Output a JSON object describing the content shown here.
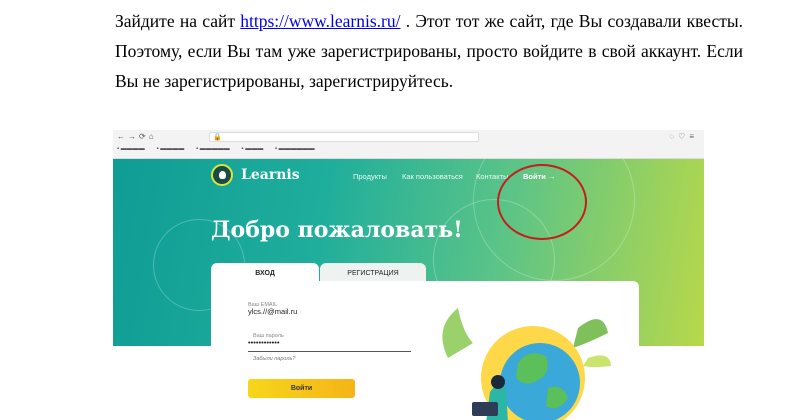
{
  "document": {
    "para_before_link": "Зайдите на сайт ",
    "link_text": "https://www.learnis.ru/",
    "para_after_link": " . Этот тот же сайт, где Вы создавали квесты. Поэтому, если Вы там уже зарегистрированы, просто войдите в свой аккаунт. Если Вы не зарегистрированы, зарегистрируйтесь."
  },
  "screenshot": {
    "site": {
      "logo_text": "Learnis",
      "nav": {
        "products": "Продукты",
        "how_to_use": "Как пользоваться",
        "contacts": "Контакты",
        "login": "Войти →"
      },
      "welcome": "Добро пожаловать!",
      "tabs": {
        "login": "ВХОД",
        "register": "РЕГИСТРАЦИЯ"
      },
      "form": {
        "email_label": "Ваш EMAIL",
        "email_value": "ylcs.//@mail.ru",
        "password_label": "Ваш пароль",
        "password_value": "••••••••••••",
        "forgot": "Забыли пароль?",
        "submit": "Войти"
      }
    },
    "colors": {
      "hero_start": "#0f9c95",
      "hero_end": "#b8d84a",
      "annotation": "#c41e1e",
      "button": "#f5c518"
    }
  }
}
